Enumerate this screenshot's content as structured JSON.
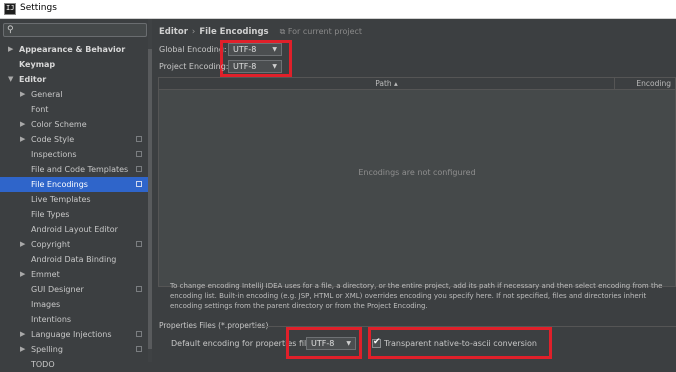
{
  "window": {
    "title": "Settings",
    "app_icon_text": "IJ"
  },
  "search": {
    "icon": "search-icon",
    "value": ""
  },
  "tree": [
    {
      "label": "Appearance & Behavior",
      "arrow": "▶",
      "bold": true,
      "indent": 0
    },
    {
      "label": "Keymap",
      "arrow": "",
      "bold": true,
      "indent": 0
    },
    {
      "label": "Editor",
      "arrow": "▼",
      "bold": true,
      "indent": 0
    },
    {
      "label": "General",
      "arrow": "▶",
      "bold": false,
      "indent": 1
    },
    {
      "label": "Font",
      "arrow": "",
      "bold": false,
      "indent": 1
    },
    {
      "label": "Color Scheme",
      "arrow": "▶",
      "bold": false,
      "indent": 1
    },
    {
      "label": "Code Style",
      "arrow": "▶",
      "bold": false,
      "indent": 1,
      "copy": true
    },
    {
      "label": "Inspections",
      "arrow": "",
      "bold": false,
      "indent": 1,
      "copy": true
    },
    {
      "label": "File and Code Templates",
      "arrow": "",
      "bold": false,
      "indent": 1,
      "copy": true
    },
    {
      "label": "File Encodings",
      "arrow": "",
      "bold": false,
      "indent": 1,
      "copy": true,
      "selected": true
    },
    {
      "label": "Live Templates",
      "arrow": "",
      "bold": false,
      "indent": 1
    },
    {
      "label": "File Types",
      "arrow": "",
      "bold": false,
      "indent": 1
    },
    {
      "label": "Android Layout Editor",
      "arrow": "",
      "bold": false,
      "indent": 1
    },
    {
      "label": "Copyright",
      "arrow": "▶",
      "bold": false,
      "indent": 1,
      "copy": true
    },
    {
      "label": "Android Data Binding",
      "arrow": "",
      "bold": false,
      "indent": 1
    },
    {
      "label": "Emmet",
      "arrow": "▶",
      "bold": false,
      "indent": 1
    },
    {
      "label": "GUI Designer",
      "arrow": "",
      "bold": false,
      "indent": 1,
      "copy": true
    },
    {
      "label": "Images",
      "arrow": "",
      "bold": false,
      "indent": 1
    },
    {
      "label": "Intentions",
      "arrow": "",
      "bold": false,
      "indent": 1
    },
    {
      "label": "Language Injections",
      "arrow": "▶",
      "bold": false,
      "indent": 1,
      "copy": true
    },
    {
      "label": "Spelling",
      "arrow": "▶",
      "bold": false,
      "indent": 1,
      "copy": true
    },
    {
      "label": "TODO",
      "arrow": "",
      "bold": false,
      "indent": 1
    }
  ],
  "breadcrumb": {
    "section": "Editor",
    "separator": "›",
    "page": "File Encodings",
    "scope_icon": "project-icon",
    "scope": "For current project"
  },
  "global_encoding": {
    "label": "Global Encoding:",
    "value": "UTF-8"
  },
  "project_encoding": {
    "label": "Project Encoding:",
    "value": "UTF-8"
  },
  "table": {
    "col_path": "Path ▴",
    "col_encoding": "Encoding",
    "empty_text": "Encodings are not configured"
  },
  "info_text": "To change encoding IntelliJ IDEA uses for a file, a directory, or the entire project, add its path if necessary and then select encoding from the encoding list. Built-in encoding (e.g. JSP, HTML or XML) overrides encoding you specify here. If not specified, files and directories inherit encoding settings from the parent directory or from the Project Encoding.",
  "properties": {
    "section_label": "Properties Files (*.properties)",
    "default_label": "Default encoding for properties files:",
    "default_value": "UTF-8",
    "native_label": "Transparent native-to-ascii conversion",
    "native_checked": true,
    "check_glyph": "✔"
  },
  "accent_colors": {
    "selection": "#2f65ca",
    "highlight_box": "#e0202a"
  }
}
